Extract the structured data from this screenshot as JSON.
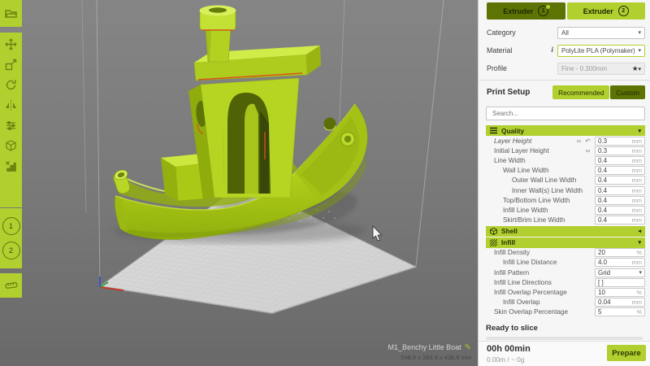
{
  "icons": {
    "link": "∞",
    "revert": "↶",
    "star": "★",
    "caret_down": "▾",
    "caret_left": "◂",
    "pencil": "✎",
    "info": "i"
  },
  "toolbar": {
    "extruder1": "1",
    "extruder2": "2"
  },
  "panel": {
    "extruder_tabs": [
      {
        "label": "Extruder",
        "number": "1"
      },
      {
        "label": "Extruder",
        "number": "2"
      }
    ],
    "config": {
      "category_label": "Category",
      "category_value": "All",
      "material_label": "Material",
      "material_value": "PolyLite PLA (Polymaker)",
      "profile_label": "Profile",
      "profile_value": "Fine - 0.300mm"
    },
    "print_setup": {
      "label": "Print Setup",
      "recommended": "Recommended",
      "custom": "Custom"
    },
    "search_placeholder": "Search...",
    "sections": {
      "quality": {
        "title": "Quality",
        "rows": [
          {
            "label": "Layer Height",
            "value": "0.3",
            "unit": "mm"
          },
          {
            "label": "Initial Layer Height",
            "value": "0.3",
            "unit": "mm"
          },
          {
            "label": "Line Width",
            "value": "0.4",
            "unit": "mm"
          },
          {
            "label": "Wall Line Width",
            "value": "0.4",
            "unit": "mm"
          },
          {
            "label": "Outer Wall Line Width",
            "value": "0.4",
            "unit": "mm"
          },
          {
            "label": "Inner Wall(s) Line Width",
            "value": "0.4",
            "unit": "mm"
          },
          {
            "label": "Top/Bottom Line Width",
            "value": "0.4",
            "unit": "mm"
          },
          {
            "label": "Infill Line Width",
            "value": "0.4",
            "unit": "mm"
          },
          {
            "label": "Skirt/Brim Line Width",
            "value": "0.4",
            "unit": "mm"
          }
        ]
      },
      "shell": {
        "title": "Shell"
      },
      "infill": {
        "title": "Infill",
        "rows": [
          {
            "label": "Infill Density",
            "value": "20",
            "unit": "%"
          },
          {
            "label": "Infill Line Distance",
            "value": "4.0",
            "unit": "mm"
          },
          {
            "label": "Infill Pattern",
            "value": "Grid",
            "unit": ""
          },
          {
            "label": "Infill Line Directions",
            "value": "[ ]",
            "unit": ""
          },
          {
            "label": "Infill Overlap Percentage",
            "value": "10",
            "unit": "%"
          },
          {
            "label": "Infill Overlap",
            "value": "0.04",
            "unit": "mm"
          },
          {
            "label": "Skin Overlap Percentage",
            "value": "5",
            "unit": "%"
          }
        ]
      }
    },
    "status": {
      "ready": "Ready to slice",
      "time": "00h 00min",
      "usage": "0.00m / ~ 0g",
      "prepare": "Prepare"
    }
  },
  "viewport": {
    "model_name": "M1_Benchy Little Boat",
    "model_dimensions": "548.5 x 283.4 x 438.8 mm"
  },
  "colors": {
    "lime": "#b2cf30",
    "olive": "#5d7404",
    "accent_red": "#d8541a",
    "model_green": "#b5d522"
  }
}
